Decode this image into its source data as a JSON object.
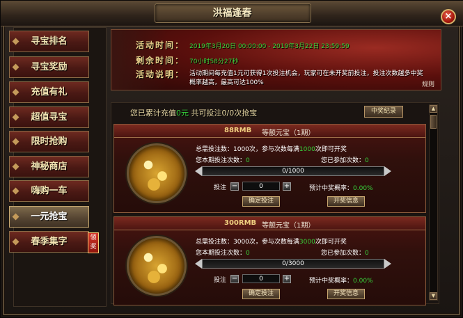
{
  "window": {
    "title": "洪福逢春",
    "close_glyph": "×"
  },
  "sidebar": {
    "items": [
      {
        "label": "寻宝排名"
      },
      {
        "label": "寻宝奖励"
      },
      {
        "label": "充值有礼"
      },
      {
        "label": "超值寻宝"
      },
      {
        "label": "限时抢购"
      },
      {
        "label": "神秘商店"
      },
      {
        "label": "嗨购一车"
      },
      {
        "label": "一元抢宝",
        "active": true
      },
      {
        "label": "春季集字"
      }
    ],
    "badge": "领奖"
  },
  "banner": {
    "time_label": "活动时间：",
    "time_value": "2019年3月20日 00:00:00 - 2019年3月22日 23:59:59",
    "remain_label": "剩余时间：",
    "remain_value": "70小时58分27秒",
    "desc_label": "活动说明：",
    "desc_value": "活动期间每充值1元可获得1次投注机会，玩家可在未开奖前投注，投注次数越多中奖概率越高，最高可达100%",
    "rules": "规则"
  },
  "summary": {
    "prefix": "您已累计充值",
    "amount": "0元",
    "mid": "  共可投注",
    "count": "0/0",
    "suffix": "次抢宝"
  },
  "record_button": "中奖纪录",
  "cards": [
    {
      "price": "88RMB",
      "subtitle": "等额元宝（1期）",
      "need_prefix": "总需投注数：1000次，参与次数每满",
      "need_hl": "1000",
      "need_suffix": "次即可开奖",
      "round_label": "您本期投注次数：",
      "round_value": "0",
      "joined_label": "您已参加次数：",
      "joined_value": "0",
      "progress_text": "0/1000",
      "progress": 0,
      "bet_label": "投注",
      "qty_value": "0",
      "rate_label": "预计中奖概率：",
      "rate_value": "0.00%",
      "confirm_label": "确定投注",
      "info_label": "开奖信息"
    },
    {
      "price": "300RMB",
      "subtitle": "等额元宝（1期）",
      "need_prefix": "总需投注数：3000次，参与次数每满",
      "need_hl": "3000",
      "need_suffix": "次即可开奖",
      "round_label": "您本期投注次数：",
      "round_value": "0",
      "joined_label": "您已参加次数：",
      "joined_value": "0",
      "progress_text": "0/3000",
      "progress": 0,
      "bet_label": "投注",
      "qty_value": "0",
      "rate_label": "预计中奖概率：",
      "rate_value": "0.00%",
      "confirm_label": "确定投注",
      "info_label": "开奖信息"
    }
  ],
  "colors": {
    "accent_green": "#37d13a",
    "gold": "#f0d080",
    "banner_red": "#5a0f0c"
  },
  "icons": {
    "close": "close-icon",
    "scroll_up": "arrow-up-icon",
    "scroll_down": "arrow-down-icon"
  }
}
